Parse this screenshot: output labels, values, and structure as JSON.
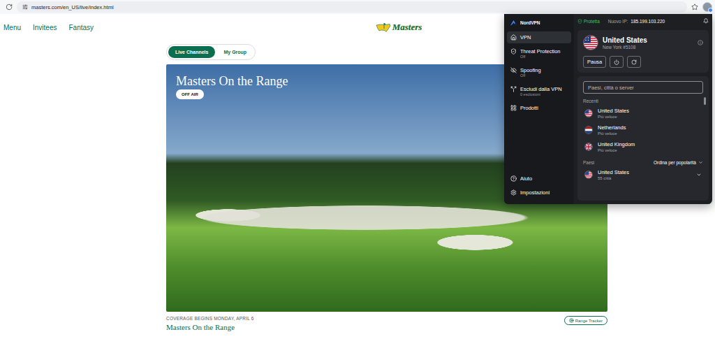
{
  "browser": {
    "url": "masters.com/en_US/live/index.html"
  },
  "site": {
    "nav": [
      "Menu",
      "Invitees",
      "Fantasy"
    ],
    "logo": "Masters",
    "toggle": [
      {
        "label": "Live Channels",
        "selected": true
      },
      {
        "label": "My Group",
        "selected": false
      }
    ],
    "player": {
      "title": "Masters On the Range",
      "badge": "OFF AIR"
    },
    "caption": {
      "kicker": "COVERAGE BEGINS MONDAY, APRIL 6",
      "title": "Masters On the Range",
      "button": "Range Tracker"
    }
  },
  "vpn": {
    "brand": "NordVPN",
    "status": "Protetta",
    "protected": true,
    "ip_label": "Nuovo IP:",
    "ip": "185.199.103.220",
    "sidebar": [
      {
        "label": "VPN",
        "sub": "",
        "kind": "home",
        "selected": true
      },
      {
        "label": "Threat Protection",
        "sub": "Off",
        "kind": "shield",
        "selected": false
      },
      {
        "label": "Spoofing",
        "sub": "Off",
        "kind": "spoof",
        "selected": false
      },
      {
        "label": "Escludi dalla VPN",
        "sub": "0 esclusioni",
        "kind": "split",
        "selected": false
      },
      {
        "label": "Prodotti",
        "sub": "",
        "kind": "grid",
        "selected": false
      }
    ],
    "sidebar_bottom": [
      {
        "label": "Aiuto",
        "kind": "help"
      },
      {
        "label": "Impostazioni",
        "kind": "settings"
      }
    ],
    "connection": {
      "country": "United States",
      "server": "New York #5108",
      "flag": "us",
      "pause": "Pausa"
    },
    "search": {
      "placeholder": "Paesi, città o server"
    },
    "recent": {
      "heading": "Recenti",
      "items": [
        {
          "name": "United States",
          "sub": "Più veloce",
          "flag": "us"
        },
        {
          "name": "Netherlands",
          "sub": "Più veloce",
          "flag": "nl"
        },
        {
          "name": "United Kingdom",
          "sub": "Più veloce",
          "flag": "uk"
        }
      ]
    },
    "countries": {
      "heading": "Paesi",
      "sort": "Ordina per popolarità",
      "items": [
        {
          "name": "United States",
          "sub": "55 città",
          "flag": "us"
        }
      ]
    }
  }
}
